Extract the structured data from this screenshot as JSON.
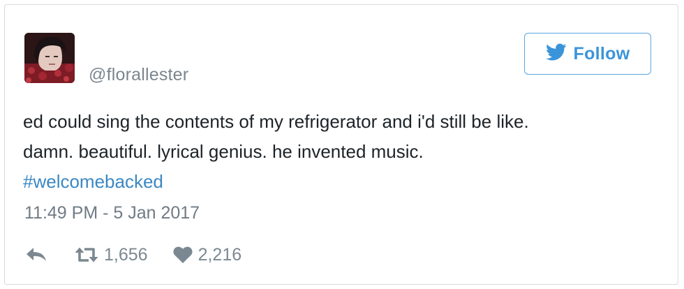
{
  "tweet": {
    "handle": "@florallester",
    "follow_label": "Follow",
    "text_lines": [
      "ed could sing the contents of my refrigerator and i'd still be like.",
      "damn. beautiful. lyrical genius. he invented music."
    ],
    "hashtag": "#welcomebacked",
    "timestamp": "11:49 PM - 5 Jan 2017",
    "retweet_count": "1,656",
    "like_count": "2,216"
  },
  "icons": {
    "follow": "twitter-bird-icon",
    "reply": "reply-icon",
    "retweet": "retweet-icon",
    "like": "heart-icon"
  },
  "colors": {
    "accent": "#3b94d9",
    "hashtag": "#3b88c3",
    "muted": "#7b868f",
    "border": "#d6dbdf"
  }
}
